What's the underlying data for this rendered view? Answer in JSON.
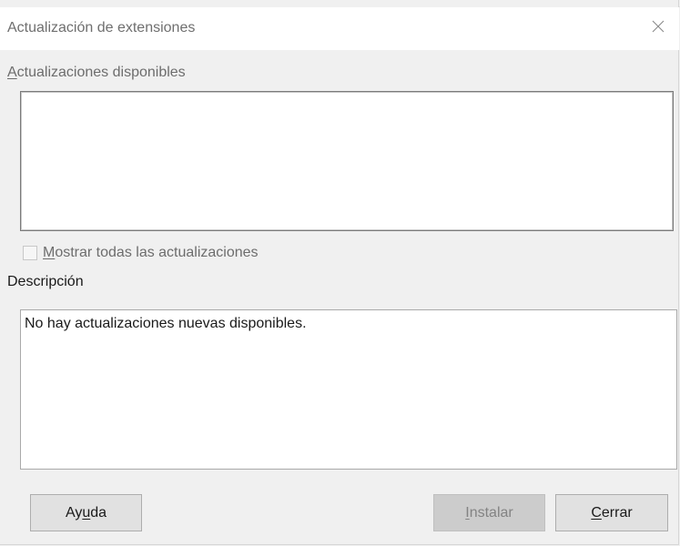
{
  "window": {
    "title": "Actualización de extensiones",
    "close_icon": "close-icon"
  },
  "updates": {
    "label_mnemonic": "A",
    "label_rest": "ctualizaciones disponibles",
    "items": []
  },
  "show_all": {
    "checked": false,
    "enabled": false,
    "label_mnemonic": "M",
    "label_rest": "ostrar todas las actualizaciones"
  },
  "description": {
    "label": "Descripción",
    "text": "No hay actualizaciones nuevas disponibles."
  },
  "buttons": {
    "help_pre": "Ay",
    "help_mnemonic": "u",
    "help_post": "da",
    "install_mnemonic": "I",
    "install_rest": "nstalar",
    "install_enabled": false,
    "close_mnemonic": "C",
    "close_rest": "errar"
  }
}
